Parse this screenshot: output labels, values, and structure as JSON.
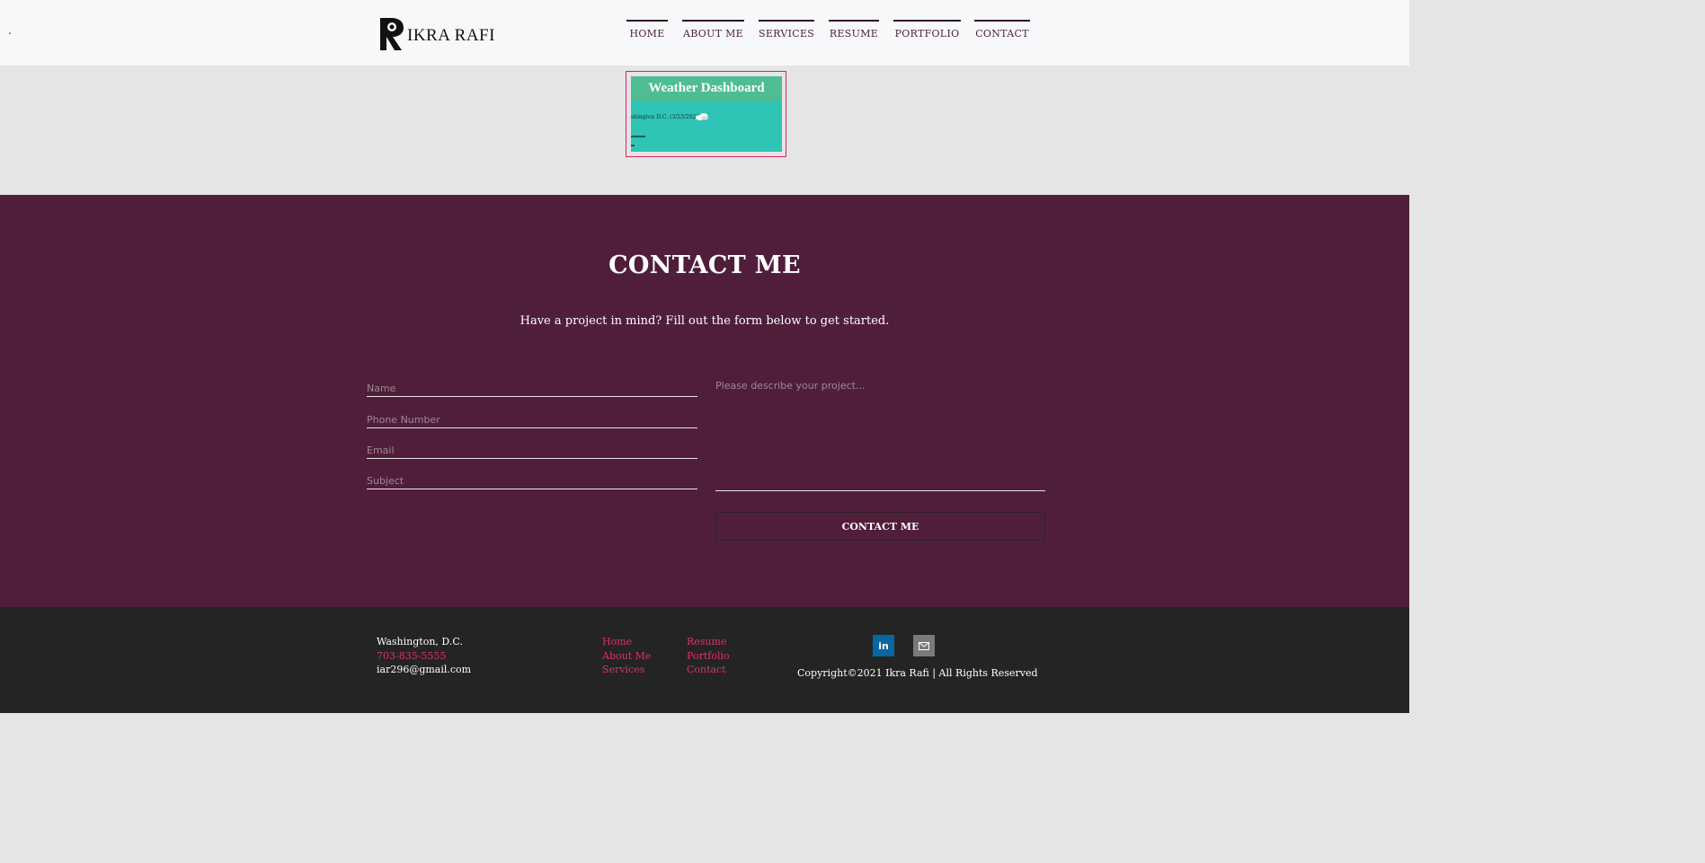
{
  "header": {
    "dot": ".",
    "logo_text": "IKRA RAFI",
    "nav": [
      {
        "label": "HOME"
      },
      {
        "label": "ABOUT ME"
      },
      {
        "label": "SERVICES"
      },
      {
        "label": "RESUME"
      },
      {
        "label": "PORTFOLIO"
      },
      {
        "label": "CONTACT"
      }
    ]
  },
  "portfolio": {
    "thumb_title": "Weather Dashboard",
    "thumb_line": "shington D.C. (3/23/2021)"
  },
  "contact": {
    "title": "CONTACT ME",
    "subtitle": "Have a project in mind? Fill out the form below to get started.",
    "fields": {
      "name": "Name",
      "phone": "Phone Number",
      "email": "Email",
      "subject": "Subject",
      "message": "Please describe your project..."
    },
    "submit_label": "CONTACT ME"
  },
  "footer": {
    "city": "Washington, D.C.",
    "phone": "703-835-5555",
    "email": "iar296@gmail.com",
    "links_col1": [
      "Home",
      "About Me",
      "Services"
    ],
    "links_col2": [
      "Resume",
      "Portfolio",
      "Contact"
    ],
    "linkedin_glyph": "in",
    "copyright": "Copyright©2021 Ikra Rafi | All Rights Reserved"
  },
  "colors": {
    "contact_bg": "#501e3b",
    "footer_bg": "#242424",
    "accent_pink": "#dc2f6b",
    "thumb_teal": "#2ec4b6",
    "thumb_header": "#4ebd93"
  },
  "icons": [
    "logo-mark-icon",
    "cloud-icon",
    "linkedin-icon",
    "mail-icon"
  ]
}
